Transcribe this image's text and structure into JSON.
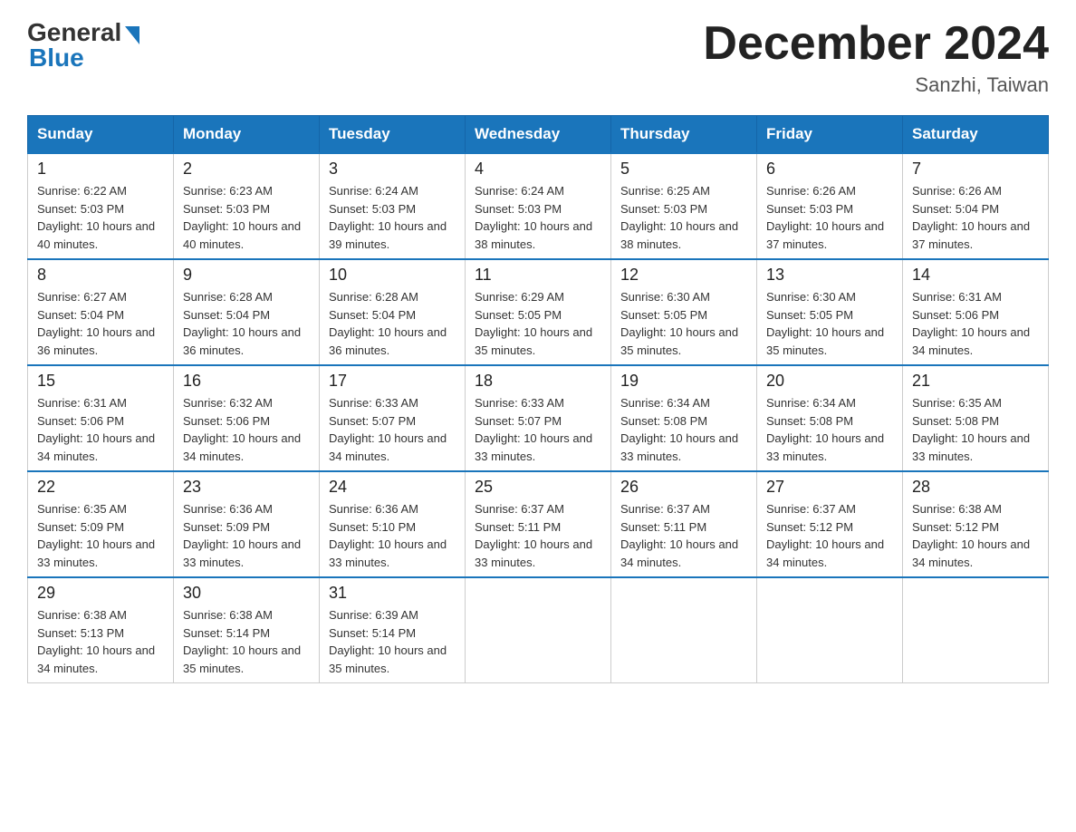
{
  "header": {
    "logo_general": "General",
    "logo_blue": "Blue",
    "month_title": "December 2024",
    "location": "Sanzhi, Taiwan"
  },
  "days_of_week": [
    "Sunday",
    "Monday",
    "Tuesday",
    "Wednesday",
    "Thursday",
    "Friday",
    "Saturday"
  ],
  "weeks": [
    [
      {
        "day": "1",
        "sunrise": "6:22 AM",
        "sunset": "5:03 PM",
        "daylight": "10 hours and 40 minutes."
      },
      {
        "day": "2",
        "sunrise": "6:23 AM",
        "sunset": "5:03 PM",
        "daylight": "10 hours and 40 minutes."
      },
      {
        "day": "3",
        "sunrise": "6:24 AM",
        "sunset": "5:03 PM",
        "daylight": "10 hours and 39 minutes."
      },
      {
        "day": "4",
        "sunrise": "6:24 AM",
        "sunset": "5:03 PM",
        "daylight": "10 hours and 38 minutes."
      },
      {
        "day": "5",
        "sunrise": "6:25 AM",
        "sunset": "5:03 PM",
        "daylight": "10 hours and 38 minutes."
      },
      {
        "day": "6",
        "sunrise": "6:26 AM",
        "sunset": "5:03 PM",
        "daylight": "10 hours and 37 minutes."
      },
      {
        "day": "7",
        "sunrise": "6:26 AM",
        "sunset": "5:04 PM",
        "daylight": "10 hours and 37 minutes."
      }
    ],
    [
      {
        "day": "8",
        "sunrise": "6:27 AM",
        "sunset": "5:04 PM",
        "daylight": "10 hours and 36 minutes."
      },
      {
        "day": "9",
        "sunrise": "6:28 AM",
        "sunset": "5:04 PM",
        "daylight": "10 hours and 36 minutes."
      },
      {
        "day": "10",
        "sunrise": "6:28 AM",
        "sunset": "5:04 PM",
        "daylight": "10 hours and 36 minutes."
      },
      {
        "day": "11",
        "sunrise": "6:29 AM",
        "sunset": "5:05 PM",
        "daylight": "10 hours and 35 minutes."
      },
      {
        "day": "12",
        "sunrise": "6:30 AM",
        "sunset": "5:05 PM",
        "daylight": "10 hours and 35 minutes."
      },
      {
        "day": "13",
        "sunrise": "6:30 AM",
        "sunset": "5:05 PM",
        "daylight": "10 hours and 35 minutes."
      },
      {
        "day": "14",
        "sunrise": "6:31 AM",
        "sunset": "5:06 PM",
        "daylight": "10 hours and 34 minutes."
      }
    ],
    [
      {
        "day": "15",
        "sunrise": "6:31 AM",
        "sunset": "5:06 PM",
        "daylight": "10 hours and 34 minutes."
      },
      {
        "day": "16",
        "sunrise": "6:32 AM",
        "sunset": "5:06 PM",
        "daylight": "10 hours and 34 minutes."
      },
      {
        "day": "17",
        "sunrise": "6:33 AM",
        "sunset": "5:07 PM",
        "daylight": "10 hours and 34 minutes."
      },
      {
        "day": "18",
        "sunrise": "6:33 AM",
        "sunset": "5:07 PM",
        "daylight": "10 hours and 33 minutes."
      },
      {
        "day": "19",
        "sunrise": "6:34 AM",
        "sunset": "5:08 PM",
        "daylight": "10 hours and 33 minutes."
      },
      {
        "day": "20",
        "sunrise": "6:34 AM",
        "sunset": "5:08 PM",
        "daylight": "10 hours and 33 minutes."
      },
      {
        "day": "21",
        "sunrise": "6:35 AM",
        "sunset": "5:08 PM",
        "daylight": "10 hours and 33 minutes."
      }
    ],
    [
      {
        "day": "22",
        "sunrise": "6:35 AM",
        "sunset": "5:09 PM",
        "daylight": "10 hours and 33 minutes."
      },
      {
        "day": "23",
        "sunrise": "6:36 AM",
        "sunset": "5:09 PM",
        "daylight": "10 hours and 33 minutes."
      },
      {
        "day": "24",
        "sunrise": "6:36 AM",
        "sunset": "5:10 PM",
        "daylight": "10 hours and 33 minutes."
      },
      {
        "day": "25",
        "sunrise": "6:37 AM",
        "sunset": "5:11 PM",
        "daylight": "10 hours and 33 minutes."
      },
      {
        "day": "26",
        "sunrise": "6:37 AM",
        "sunset": "5:11 PM",
        "daylight": "10 hours and 34 minutes."
      },
      {
        "day": "27",
        "sunrise": "6:37 AM",
        "sunset": "5:12 PM",
        "daylight": "10 hours and 34 minutes."
      },
      {
        "day": "28",
        "sunrise": "6:38 AM",
        "sunset": "5:12 PM",
        "daylight": "10 hours and 34 minutes."
      }
    ],
    [
      {
        "day": "29",
        "sunrise": "6:38 AM",
        "sunset": "5:13 PM",
        "daylight": "10 hours and 34 minutes."
      },
      {
        "day": "30",
        "sunrise": "6:38 AM",
        "sunset": "5:14 PM",
        "daylight": "10 hours and 35 minutes."
      },
      {
        "day": "31",
        "sunrise": "6:39 AM",
        "sunset": "5:14 PM",
        "daylight": "10 hours and 35 minutes."
      },
      null,
      null,
      null,
      null
    ]
  ]
}
